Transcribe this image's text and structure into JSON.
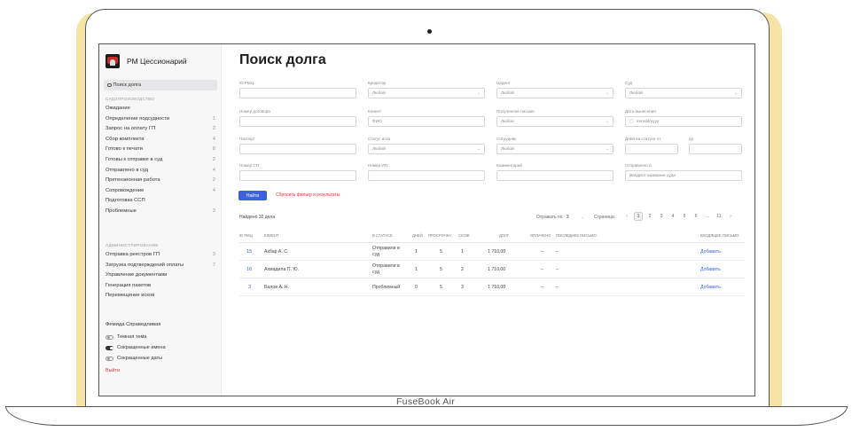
{
  "device": {
    "brand": "FuseBook Air"
  },
  "app": {
    "title": "РМ Цессионарий"
  },
  "sidebar": {
    "search_label": "Поиск долга",
    "sections": [
      {
        "header": "СУДОПРОИЗВОДСТВО",
        "items": [
          {
            "label": "Ожидание",
            "count": ""
          },
          {
            "label": "Определение подсудности",
            "count": "1"
          },
          {
            "label": "Запрос на оплату ГП",
            "count": "2"
          },
          {
            "label": "Сбор комплекта",
            "count": "4"
          },
          {
            "label": "Готово к печати",
            "count": "8"
          },
          {
            "label": "Готовы к отправке в суд",
            "count": "2"
          },
          {
            "label": "Отправлено в суд",
            "count": "4"
          },
          {
            "label": "Претензионная работа",
            "count": "2"
          },
          {
            "label": "Сопровождение",
            "count": "4"
          },
          {
            "label": "Подготовка ССП",
            "count": ""
          },
          {
            "label": "Проблемные",
            "count": "3"
          }
        ]
      },
      {
        "header": "АДМИНИСТРИРОВАНИЕ",
        "items": [
          {
            "label": "Отправка реестров ГП",
            "count": "3"
          },
          {
            "label": "Загрузка подтверждений оплаты",
            "count": "7"
          },
          {
            "label": "Управление документами",
            "count": ""
          },
          {
            "label": "Генерация пакетов",
            "count": ""
          },
          {
            "label": "Перемещение исков",
            "count": ""
          }
        ]
      }
    ],
    "org_name": "Фемида Справедливая",
    "toggles": [
      {
        "label": "Темная тема",
        "on": false
      },
      {
        "label": "Сокращенные имена",
        "on": true
      },
      {
        "label": "Сокращенные даты",
        "on": false
      }
    ],
    "logout": "Выйти"
  },
  "main": {
    "title": "Поиск долга",
    "filters": {
      "id_rmc": {
        "label": "ID РМЦ",
        "value": ""
      },
      "creditor": {
        "label": "Кредитор",
        "value": "Любой"
      },
      "cedent": {
        "label": "Цедент",
        "value": "Любой"
      },
      "court": {
        "label": "Суд",
        "value": "Любой"
      },
      "contract": {
        "label": "Номер договора",
        "value": ""
      },
      "client": {
        "label": "Клиент",
        "placeholder": "ФИО"
      },
      "letter": {
        "label": "Полученное письмо",
        "value": "Любое"
      },
      "issue_date": {
        "label": "Дата вынесения",
        "placeholder": "mm/dd/yyyy"
      },
      "passport": {
        "label": "Паспорт",
        "value": ""
      },
      "claim_status": {
        "label": "Статус иска",
        "value": "Любой"
      },
      "employee": {
        "label": "Сотрудник",
        "value": "Любой"
      },
      "days_from": {
        "label": "Дней на статусе от",
        "value": ""
      },
      "days_to": {
        "label": "до",
        "value": ""
      },
      "sp_number": {
        "label": "Номер СП",
        "value": ""
      },
      "ip_number": {
        "label": "Номер ИП",
        "value": ""
      },
      "comment": {
        "label": "Комментарий",
        "value": ""
      },
      "sent_to": {
        "label": "Отправлено в",
        "placeholder": "Введите название суда"
      }
    },
    "find_button": "Найти",
    "reset_link": "Сбросить фильтр и результаты",
    "found_text": "Найдено 32 дела",
    "show_per_label": "Отражать по",
    "show_per_value": "3",
    "pager_label": "Страница:",
    "pages": [
      "‹",
      "1",
      "2",
      "3",
      "4",
      "5",
      "6",
      "…",
      "11",
      "›"
    ],
    "active_page": "1",
    "table": {
      "headers": [
        "ID РМЦ",
        "КЛИЕНТ",
        "В СТАТУСЕ",
        "ДНЕЙ",
        "ПРОСРОЧКА",
        "СХОЖ",
        "ДОЛГ",
        "ОПЛАЧЕНО",
        "ПОСЛЕДНЕЕ ПИСЬМО",
        "ВХОДЯЩЕЕ ПИСЬМО"
      ],
      "rows": [
        {
          "id": "15",
          "client": "Акбар А. С.",
          "status": "Отправили в суд",
          "days": "1",
          "overdue": "5",
          "sim": "1",
          "debt": "1 710,00",
          "paid": "–",
          "last_letter": "–",
          "action": "Добавить"
        },
        {
          "id": "16",
          "client": "Ахмадила П. Ю.",
          "status": "Отправили в суд",
          "days": "1",
          "overdue": "5",
          "sim": "2",
          "debt": "1 710,00",
          "paid": "–",
          "last_letter": "–",
          "action": "Добавить"
        },
        {
          "id": "3",
          "client": "Балов А. Н.",
          "status": "Проблемный",
          "days": "0",
          "overdue": "5",
          "sim": "3",
          "debt": "1 710,00",
          "paid": "–",
          "last_letter": "–",
          "action": "Добавить"
        }
      ]
    }
  }
}
